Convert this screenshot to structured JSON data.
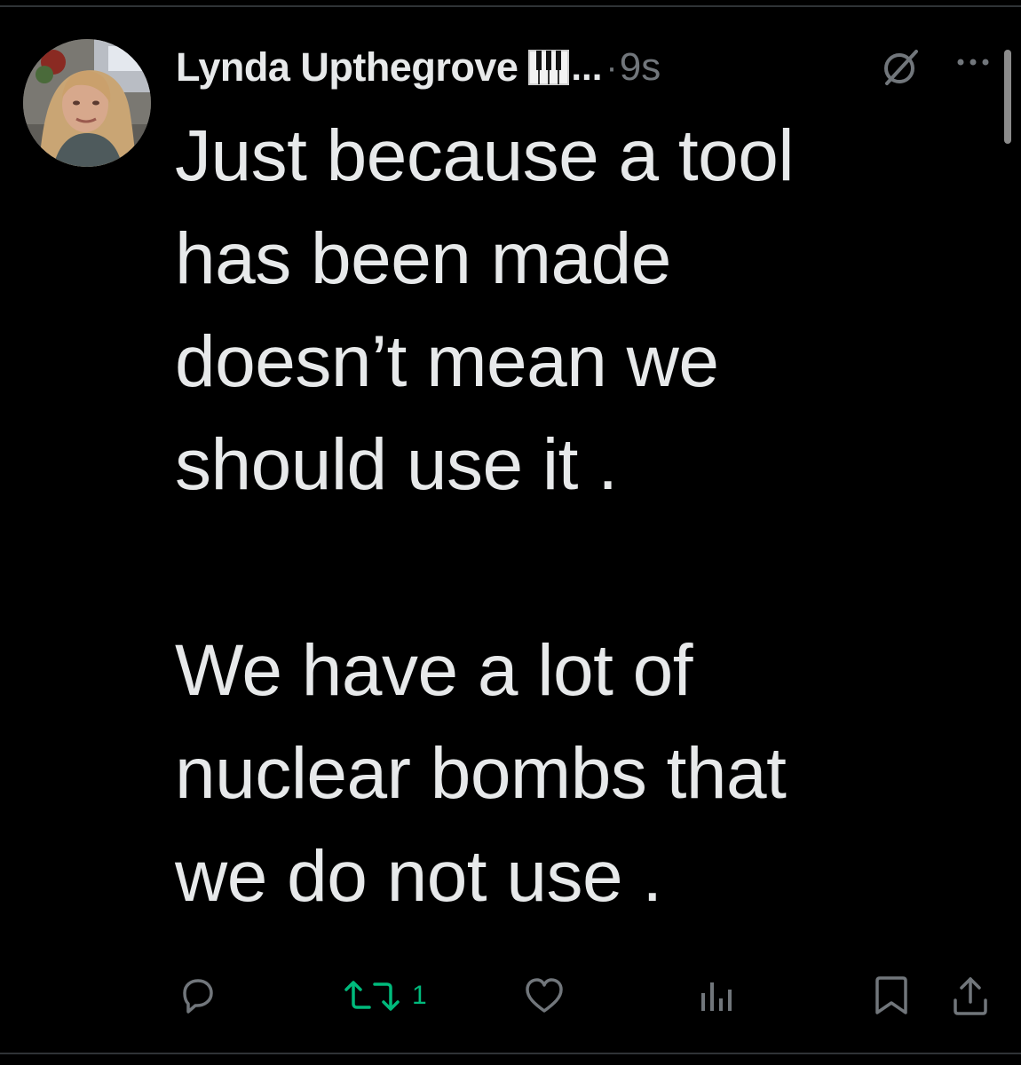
{
  "post": {
    "author_name": "Lynda Upthegrove",
    "name_truncation": "...",
    "separator": "·",
    "timestamp": "9s",
    "text": "Just because a tool\nhas been made\ndoesn’t mean we\nshould use it .\n\nWe have a lot of\nnuclear bombs that\nwe do not use ."
  },
  "icons": {
    "avatar": "avatar",
    "name_emoji": "piano-keys-icon",
    "grok": "grok-icon",
    "more": "more-icon",
    "reply": "reply-icon",
    "retweet": "retweet-icon",
    "like": "heart-icon",
    "views": "views-icon",
    "bookmark": "bookmark-icon",
    "share": "share-icon"
  },
  "actions": {
    "retweet_count": "1"
  },
  "colors": {
    "background": "#000000",
    "text": "#e7e9ea",
    "muted": "#71767b",
    "retweet_active": "#00ba7c",
    "divider": "#2f3336"
  }
}
